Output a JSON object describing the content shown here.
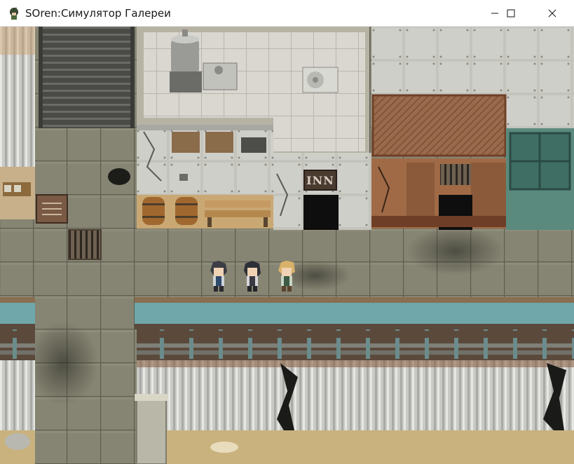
{
  "window": {
    "title": "SOren:Симулятор Галереи",
    "icon": "app-character-icon",
    "controls": [
      "minimize-icon",
      "maximize-icon",
      "close-icon"
    ]
  },
  "map": {
    "signs": {
      "inn": "INN"
    },
    "party": [
      "character-dark-haired-1",
      "character-dark-haired-2",
      "character-blonde"
    ],
    "colors": {
      "floor": "#7b7a6a",
      "water": "#6fa7ab",
      "rust_wall": "#8c5a3c",
      "metal_wall": "#c9c9c3"
    }
  }
}
